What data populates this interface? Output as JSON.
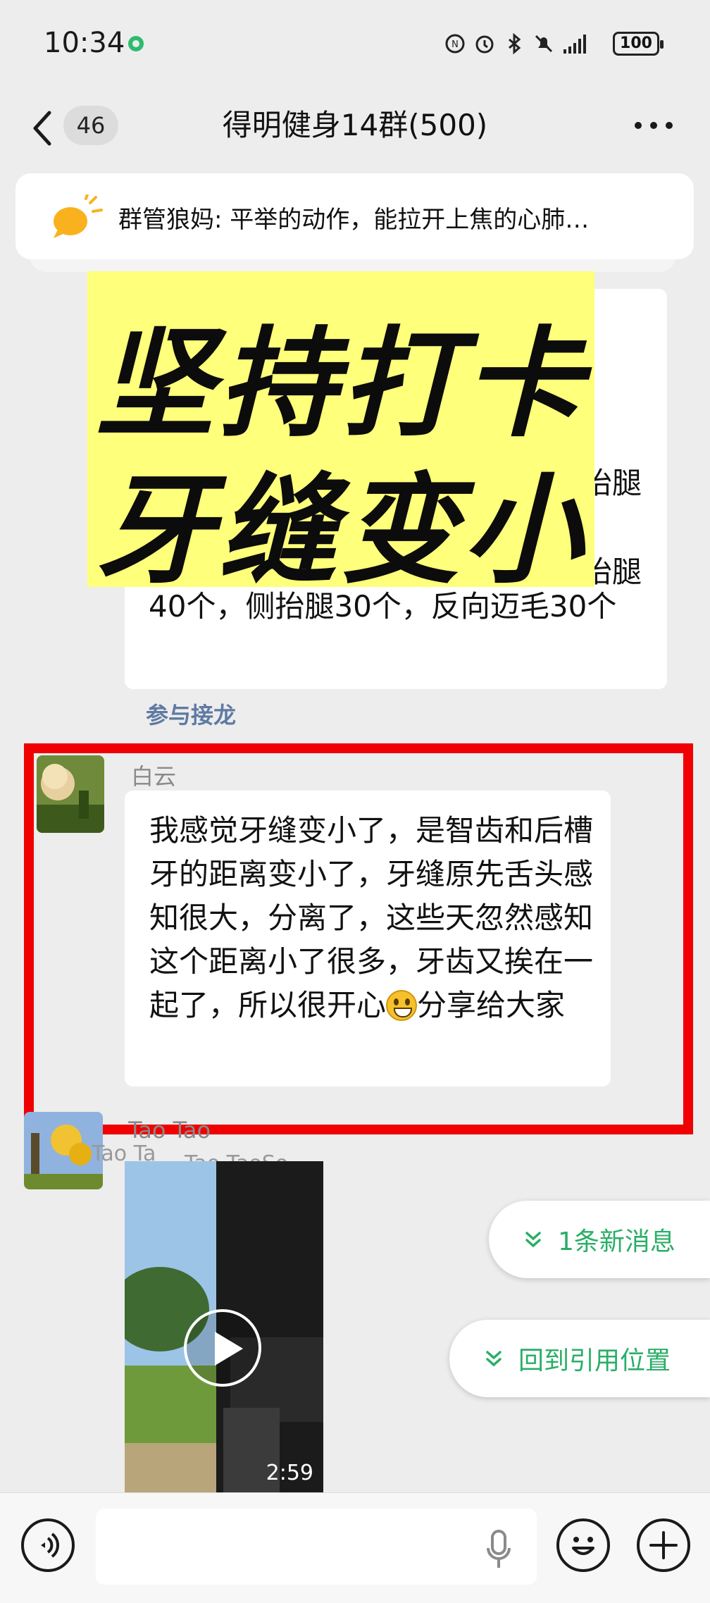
{
  "status_bar": {
    "time": "10:34",
    "battery": "100"
  },
  "nav": {
    "unread_count": "46",
    "title": "得明健身14群(500)"
  },
  "announcement": {
    "text": "群管狼妈: 平举的动作，能拉开上焦的心肺…"
  },
  "message_1": {
    "fragment_a": "抬腿",
    "fragment_b": "抬腿",
    "text": "40个，侧抬腿30个，反向迈毛30个",
    "relay_link": "参与接龙"
  },
  "overlay": {
    "line1": "坚持打卡",
    "line2": "牙缝变小"
  },
  "message_2": {
    "sender": "白云",
    "text_before_emoji": "我感觉牙缝变小了，是智齿和后槽牙的距离变小了，牙缝原先舌头感知很大，分离了，这些天忽然感知这个距离小了很多，牙齿又挨在一起了，所以很开心",
    "text_after_emoji": "分享给大家"
  },
  "message_3": {
    "sender": "Tao Tao",
    "quote_ghost": "Tao Ta",
    "quote_ghost_2": "Tao TaoSo",
    "video_duration": "2:59"
  },
  "floating": {
    "new_messages": "1条新消息",
    "back_to_quote": "回到引用位置"
  },
  "colors": {
    "accent_green": "#2aae67",
    "overlay_yellow": "#feff7b",
    "highlight_red": "#f00000",
    "link_blue": "#5f7aa3"
  },
  "icons": [
    "back-icon",
    "more-icon",
    "announcement-icon",
    "play-icon",
    "chevron-down-icon",
    "voice-icon",
    "mic-icon",
    "emoji-icon",
    "plus-icon"
  ]
}
